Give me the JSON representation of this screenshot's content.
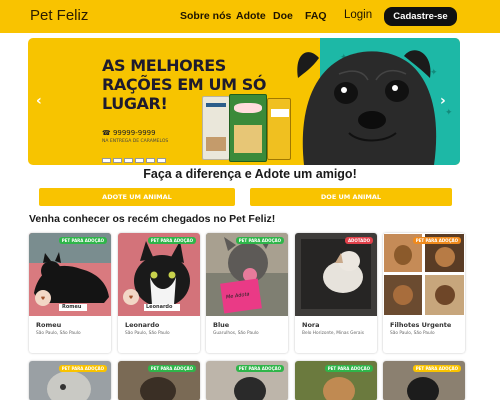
{
  "header": {
    "logo": "Pet Feliz",
    "nav": [
      "Sobre nós",
      "Adote",
      "Doe",
      "FAQ"
    ],
    "login": "Login",
    "signup": "Cadastre-se",
    "accent": "#f9c300"
  },
  "banner": {
    "headline": "AS MELHORES RAÇÕES EM UM SÓ LUGAR!",
    "phone": "☎ 99999-9999",
    "sub": "NA ENTREGA DE CARAMELOS",
    "teal": "#1db8a6"
  },
  "adopt": {
    "title": "Faça a diferença e Adote um amigo!",
    "btn_adopt": "ADOTE UM ANIMAL",
    "btn_donate": "DOE UM ANIMAL"
  },
  "recent_title": "Venha conhecer os recém chegados no Pet Feliz!",
  "cards": [
    {
      "name": "Romeu",
      "location": "São Paulo, São Paulo",
      "badge": "PET PARA ADOÇÃO",
      "badge_color": "#2fb54a"
    },
    {
      "name": "Leonardo",
      "location": "São Paulo, São Paulo",
      "badge": "PET PARA ADOÇÃO",
      "badge_color": "#2fb54a"
    },
    {
      "name": "Blue",
      "location": "Guarulhos, São Paulo",
      "badge": "PET PARA ADOÇÃO",
      "badge_color": "#2fb54a"
    },
    {
      "name": "Nora",
      "location": "Belo Horizonte, Minas Gerais",
      "badge": "ADOTADO",
      "badge_color": "#e0404a"
    },
    {
      "name": "Filhotes Urgente",
      "location": "São Paulo, São Paulo",
      "badge": "PET PARA ADOÇÃO",
      "badge_color": "#f08a1c"
    }
  ],
  "cards_row2_badges": [
    {
      "badge": "PET PARA ADOÇÃO",
      "badge_color": "#f9c300"
    },
    {
      "badge": "PET PARA ADOÇÃO",
      "badge_color": "#2fb54a"
    },
    {
      "badge": "PET PARA ADOÇÃO",
      "badge_color": "#2fb54a"
    },
    {
      "badge": "PET PARA ADOÇÃO",
      "badge_color": "#2fb54a"
    },
    {
      "badge": "PET PARA ADOÇÃO",
      "badge_color": "#f9c300"
    }
  ],
  "dog_sign": "Me Adota"
}
